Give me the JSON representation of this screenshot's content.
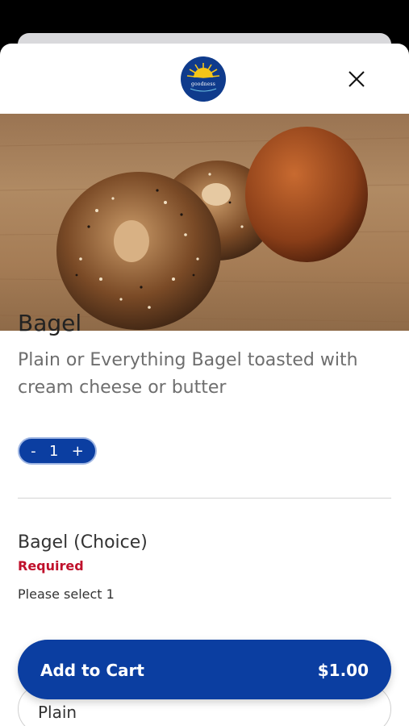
{
  "header": {
    "logo_text": "goodness",
    "close_icon": "close-icon"
  },
  "colors": {
    "brand_blue": "#0b3ea1",
    "required_red": "#c0112c"
  },
  "product": {
    "image_icon": "bagel-photo",
    "title": "Bagel",
    "description": "Plain or Everything Bagel toasted with cream cheese or butter"
  },
  "quantity": {
    "decrement_label": "-",
    "value": "1",
    "increment_label": "+"
  },
  "option_group": {
    "title": "Bagel (Choice)",
    "required_label": "Required",
    "hint": "Please select 1",
    "options": [
      {
        "label": "Plain"
      }
    ]
  },
  "cart_button": {
    "label": "Add to Cart",
    "price": "$1.00"
  }
}
